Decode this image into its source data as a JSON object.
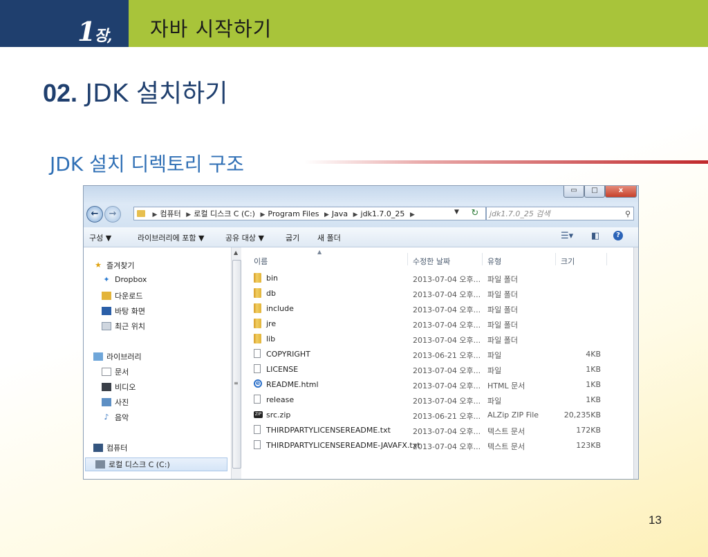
{
  "slide": {
    "chapter_num": "1",
    "chapter_suffix": "장,",
    "header_title": "자바 시작하기",
    "title_num": "02.",
    "title_text": "JDK 설치하기",
    "subtitle": "JDK 설치 디렉토리 구조",
    "page_number": "13",
    "colors": {
      "navy": "#1f3f6e",
      "green": "#a8c43a",
      "blue_text": "#2f6fb5",
      "red_line": "#c0282b"
    }
  },
  "explorer": {
    "window_buttons": {
      "minimize": "▭",
      "maximize": "□",
      "close": "x"
    },
    "nav_back": "←",
    "nav_forward": "→",
    "breadcrumb": [
      "컴퓨터",
      "로컬 디스크 C (C:)",
      "Program Files",
      "Java",
      "jdk1.7.0_25"
    ],
    "search_placeholder": "jdk1.7.0_25 검색",
    "toolbar": {
      "organize": "구성 ▼",
      "include_library": "라이브러리에 포함 ▼",
      "share_with": "공유 대상 ▼",
      "burn": "굽기",
      "new_folder": "새 폴더"
    },
    "nav_pane": {
      "favorites": "즐겨찾기",
      "dropbox": "Dropbox",
      "downloads": "다운로드",
      "desktop": "바탕 화면",
      "recent": "최근 위치",
      "libraries": "라이브러리",
      "documents": "문서",
      "videos": "비디오",
      "pictures": "사진",
      "music": "음악",
      "computer": "컴퓨터",
      "local_disk": "로컬 디스크 C (C:)"
    },
    "columns": {
      "name": "이름",
      "date": "수정한 날짜",
      "type": "유형",
      "size": "크기"
    },
    "files": [
      {
        "name": "bin",
        "date": "2013-07-04 오후...",
        "type": "파일 폴더",
        "size": "",
        "icon": "folder-icon"
      },
      {
        "name": "db",
        "date": "2013-07-04 오후...",
        "type": "파일 폴더",
        "size": "",
        "icon": "folder-icon"
      },
      {
        "name": "include",
        "date": "2013-07-04 오후...",
        "type": "파일 폴더",
        "size": "",
        "icon": "folder-icon"
      },
      {
        "name": "jre",
        "date": "2013-07-04 오후...",
        "type": "파일 폴더",
        "size": "",
        "icon": "folder-icon"
      },
      {
        "name": "lib",
        "date": "2013-07-04 오후...",
        "type": "파일 폴더",
        "size": "",
        "icon": "folder-icon"
      },
      {
        "name": "COPYRIGHT",
        "date": "2013-06-21 오후...",
        "type": "파일",
        "size": "4KB",
        "icon": "file-icon"
      },
      {
        "name": "LICENSE",
        "date": "2013-07-04 오후...",
        "type": "파일",
        "size": "1KB",
        "icon": "file-icon"
      },
      {
        "name": "README.html",
        "date": "2013-07-04 오후...",
        "type": "HTML 문서",
        "size": "1KB",
        "icon": "ie-html-icon"
      },
      {
        "name": "release",
        "date": "2013-07-04 오후...",
        "type": "파일",
        "size": "1KB",
        "icon": "file-icon"
      },
      {
        "name": "src.zip",
        "date": "2013-06-21 오후...",
        "type": "ALZip ZIP File",
        "size": "20,235KB",
        "icon": "zip-icon"
      },
      {
        "name": "THIRDPARTYLICENSEREADME.txt",
        "date": "2013-07-04 오후...",
        "type": "텍스트 문서",
        "size": "172KB",
        "icon": "file-icon"
      },
      {
        "name": "THIRDPARTYLICENSEREADME-JAVAFX.txt",
        "date": "2013-07-04 오후...",
        "type": "텍스트 문서",
        "size": "123KB",
        "icon": "file-icon"
      }
    ]
  }
}
